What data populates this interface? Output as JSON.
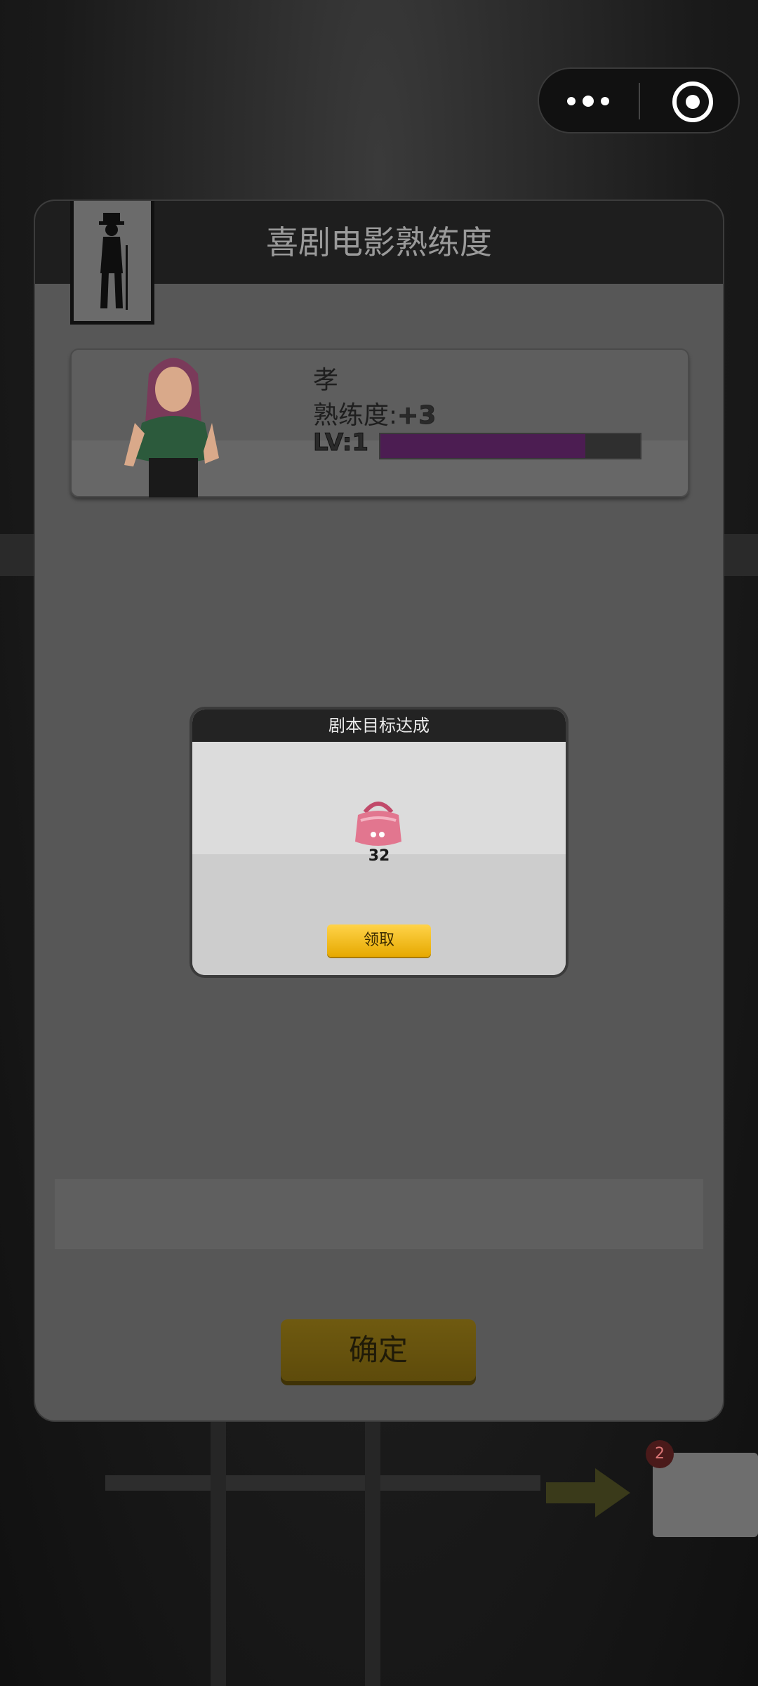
{
  "capsule": {
    "more_icon": "more-dots-icon",
    "close_icon": "target-close-icon"
  },
  "panel": {
    "title": "喜剧电影熟练度",
    "badge_icon": "chaplin-silhouette-icon"
  },
  "actor": {
    "name": "孝",
    "proficiency_label": "熟练度:",
    "proficiency_value": "+3",
    "level_label": "LV:1",
    "level_progress": 0.79
  },
  "modal": {
    "title": "剧本目标达成",
    "reward_icon": "pink-bag-icon",
    "reward_count": "32",
    "claim_label": "领取"
  },
  "footer": {
    "confirm_label": "确定"
  },
  "background": {
    "badge_count": "2"
  },
  "colors": {
    "level_fill": "#4c1d52",
    "claim_button": "#ffd34a",
    "confirm_button": "#6f5a10"
  }
}
